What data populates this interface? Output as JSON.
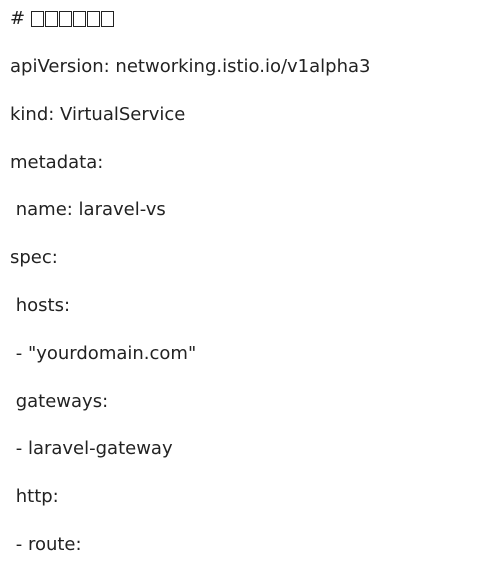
{
  "document": {
    "comment_prefix": "# ",
    "comment_glyph_count": 6,
    "lines": [
      "apiVersion: networking.istio.io/v1alpha3",
      "kind: VirtualService",
      "metadata:",
      " name: laravel-vs",
      "spec:",
      " hosts:",
      " - \"yourdomain.com\"",
      " gateways:",
      " - laravel-gateway",
      " http:",
      " - route:"
    ]
  }
}
